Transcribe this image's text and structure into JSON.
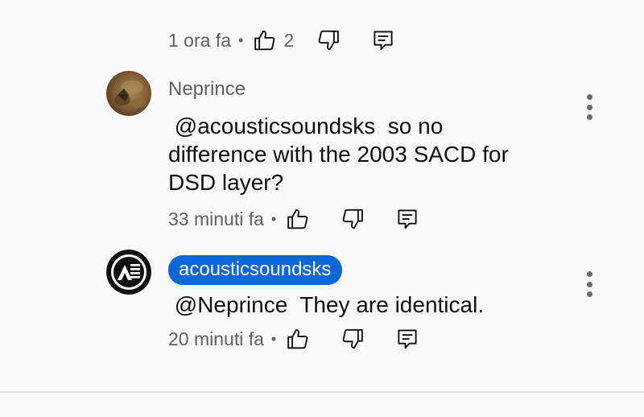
{
  "comments": [
    {
      "time": "1 ora fa",
      "separator": "•",
      "likes": "2",
      "icons": {
        "like": "thumb-up-icon",
        "dislike": "thumb-down-icon",
        "reply": "reply-comment-icon"
      }
    },
    {
      "author": "Neprince",
      "text": " @acousticsoundsks  so no difference with the 2003 SACD for DSD layer?",
      "time": "33 minuti fa",
      "separator": "•",
      "icons": {
        "avatar": "avatar-photo",
        "menu": "more-vertical-icon",
        "like": "thumb-up-icon",
        "dislike": "thumb-down-icon",
        "reply": "reply-comment-icon"
      }
    },
    {
      "author": "acousticsoundsks",
      "author_is_creator": true,
      "text": " @Neprince  They are identical.",
      "time": "20 minuti fa",
      "separator": "•",
      "icons": {
        "avatar": "channel-logo-avatar",
        "menu": "more-vertical-icon",
        "like": "thumb-up-icon",
        "dislike": "thumb-down-icon",
        "reply": "reply-comment-icon"
      }
    }
  ],
  "colors": {
    "background": "#f9f9f9",
    "creator_chip": "#0f66d6",
    "secondary_text": "#606060",
    "primary_text": "#0f0f0f"
  }
}
